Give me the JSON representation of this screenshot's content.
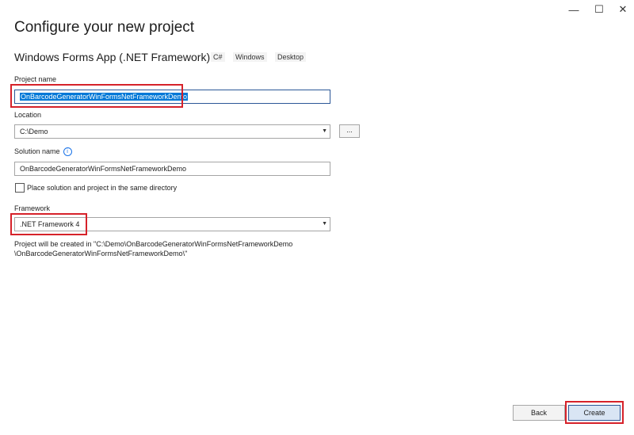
{
  "window": {
    "minimize_glyph": "—",
    "maximize_glyph": "☐",
    "close_glyph": "✕"
  },
  "page": {
    "title": "Configure your new project",
    "template_name": "Windows Forms App (.NET Framework)",
    "tags": [
      "C#",
      "Windows",
      "Desktop"
    ]
  },
  "form": {
    "project_name_label": "Project name",
    "project_name_value": "OnBarcodeGeneratorWinFormsNetFrameworkDemo",
    "location_label": "Location",
    "location_value": "C:\\Demo",
    "browse_label": "...",
    "solution_name_label": "Solution name",
    "solution_name_value": "OnBarcodeGeneratorWinFormsNetFrameworkDemo",
    "same_dir_label": "Place solution and project in the same directory",
    "same_dir_checked": false,
    "framework_label": "Framework",
    "framework_value": ".NET Framework 4",
    "info_line1": "Project will be created in \"C:\\Demo\\OnBarcodeGeneratorWinFormsNetFrameworkDemo",
    "info_line2": "\\OnBarcodeGeneratorWinFormsNetFrameworkDemo\\\""
  },
  "footer": {
    "back_label": "Back",
    "create_label": "Create"
  },
  "colors": {
    "highlight": "#d6222a",
    "selection": "#0078d7",
    "accent_border": "#2b5797"
  }
}
